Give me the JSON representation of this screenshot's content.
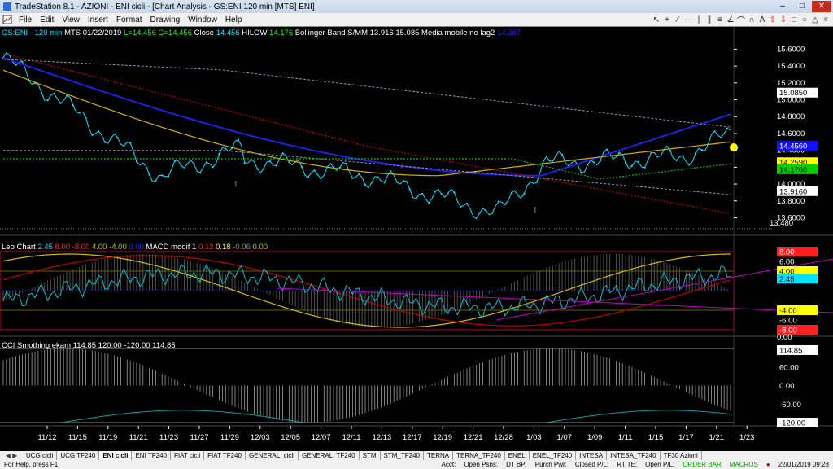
{
  "window": {
    "title": "TradeStation 8.1 - AZIONI - ENI cicli - [Chart Analysis - GS:ENI  120 min  [MTS] ENI]"
  },
  "menu": [
    "File",
    "Edit",
    "View",
    "Insert",
    "Format",
    "Drawing",
    "Window",
    "Help"
  ],
  "price_header": {
    "symbol": "GS:ENI - 120 min",
    "mts": "MTS",
    "date": "01/22/2019",
    "low": "L=14.456",
    "close": "C=14.456",
    "close_label": "Close",
    "close_val": "14.456",
    "hilow_label": "HILOW",
    "hilow_val": "14.176",
    "bb_label": "Bollinger Band S/MM",
    "bb_val1": "13.916",
    "bb_val2": "15.085",
    "ma_label": "Media mobile no lag2",
    "ma_val": "14.387"
  },
  "price_axis": [
    "15.6000",
    "15.4000",
    "15.2000",
    "15.0000",
    "14.8000",
    "14.6000",
    "14.4000",
    "14.2000",
    "14.0000",
    "13.8000",
    "13.6000"
  ],
  "price_tags": [
    {
      "text": "15.0850",
      "bg": "#ffffff",
      "fg": "#000000"
    },
    {
      "text": "14.4560",
      "bg": "#1010ff",
      "fg": "#ffffff"
    },
    {
      "text": "14.2590",
      "bg": "#ffff00",
      "fg": "#000000"
    },
    {
      "text": "14.1760",
      "bg": "#00d000",
      "fg": "#000000"
    },
    {
      "text": "13.9160",
      "bg": "#ffffff",
      "fg": "#000000"
    }
  ],
  "low_label": "13.480",
  "leo_header": {
    "name": "Leo Chart",
    "v1": "2.45",
    "v2": "8.00",
    "v3": "-8.00",
    "v4": "4.00",
    "v5": "-4.00",
    "v6": "0.00",
    "macd": "MACD modif 1",
    "m1": "0.12",
    "m2": "0.18",
    "m3": "-0.06",
    "m4": "0.00"
  },
  "leo_axis": [
    {
      "text": "8.00",
      "bg": "#ff2020",
      "fg": "#ffffff"
    },
    {
      "text": "6.00",
      "bg": "",
      "fg": "#ffffff"
    },
    {
      "text": "4.00",
      "bg": "#ffff00",
      "fg": "#000000"
    },
    {
      "text": "2.45",
      "bg": "#00e0ff",
      "fg": "#000000"
    },
    {
      "text": "-4.00",
      "bg": "#ffff00",
      "fg": "#000000"
    },
    {
      "text": "-6.00",
      "bg": "",
      "fg": "#ffffff"
    },
    {
      "text": "-8.00",
      "bg": "#ff2020",
      "fg": "#ffffff"
    }
  ],
  "leo_extra": "0.00",
  "cci_header": {
    "name": "CCI Smothing ekam",
    "v1": "114.85",
    "v2": "120.00",
    "v3": "-120.00",
    "v4": "114.85"
  },
  "cci_axis": [
    {
      "text": "114.85",
      "bg": "#ffffff",
      "fg": "#000000"
    },
    {
      "text": "60.00",
      "bg": "",
      "fg": "#ffffff"
    },
    {
      "text": "0.00",
      "bg": "",
      "fg": "#ffffff"
    },
    {
      "text": "-60.00",
      "bg": "",
      "fg": "#ffffff"
    },
    {
      "text": "-120.00",
      "bg": "#ffffff",
      "fg": "#000000"
    }
  ],
  "date_axis": [
    "11/12",
    "11/15",
    "11/19",
    "11/21",
    "11/23",
    "11/27",
    "11/29",
    "12/03",
    "12/05",
    "12/07",
    "12/11",
    "12/13",
    "12/17",
    "12/19",
    "12/21",
    "12/28",
    "1/03",
    "1/07",
    "1/09",
    "1/11",
    "1/15",
    "1/17",
    "1/21",
    "1/23"
  ],
  "tabs": [
    "UCG cicli",
    "UCG TF240",
    "ENI cicli",
    "ENI TF240",
    "FIAT cicli",
    "FIAT TF240",
    "GENERALI cicli",
    "GENERALI TF240",
    "STM",
    "STM_TF240",
    "TERNA",
    "TERNA_TF240",
    "ENEL",
    "ENEL_TF240",
    "INTESA",
    "INTESA_TF240",
    "TF30 Azioni"
  ],
  "active_tab": "ENI cicli",
  "status": {
    "help": "For Help, press F1",
    "acct": "Acct:",
    "open_psns": "Open Psns:",
    "dt_bp": "DT BP:",
    "purch_pwr": "Purch Pwr:",
    "closed_pl": "Closed P/L:",
    "rt_te": "RT TE:",
    "open_pl": "Open P/L:",
    "order_bar": "ORDER BAR",
    "macros": "MACROS",
    "datetime": "22/01/2019 09:28"
  }
}
